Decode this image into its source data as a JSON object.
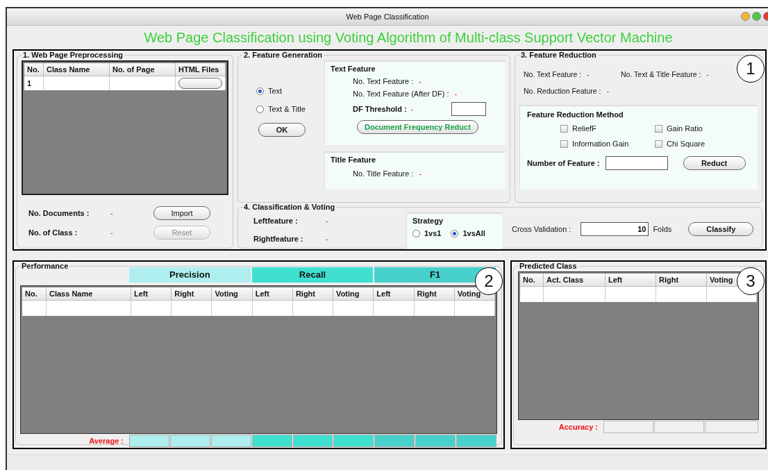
{
  "window": {
    "title": "Web Page Classification",
    "controls": [
      {
        "color": "#f2b630"
      },
      {
        "color": "#4cc94c"
      },
      {
        "color": "#e43b2f"
      }
    ]
  },
  "heading": "Web Page Classification using Voting Algorithm of Multi-class Support Vector Machine",
  "preprocessing": {
    "title": "1. Web Page Preprocessing",
    "columns": [
      "No.",
      "Class Name",
      "No. of Page",
      "HTML Files"
    ],
    "rows": [
      {
        "no": "1"
      }
    ],
    "stats": [
      {
        "label": "No. Documents :",
        "value": "-",
        "button": {
          "label": "Import",
          "disabled": false
        }
      },
      {
        "label": "No. of Class :",
        "value": "-",
        "button": {
          "label": "Reset",
          "disabled": true
        }
      }
    ]
  },
  "feature_generation": {
    "title": "2. Feature Generation",
    "options": [
      {
        "label": "Text",
        "selected": true
      },
      {
        "label": "Text & Title",
        "selected": false
      }
    ],
    "ok_button": "OK",
    "text_feature": {
      "title": "Text Feature",
      "stats": [
        {
          "label": "No. Text Feature :",
          "value": "-"
        },
        {
          "label": "No. Text Feature (After DF) :",
          "value": "-"
        }
      ],
      "threshold_label": "DF Threshold :",
      "threshold_value": "-",
      "button": "Document Frequency Reduct"
    },
    "title_feature": {
      "title": "Title Feature",
      "stats": [
        {
          "label": "No. Title Feature :",
          "value": "-"
        }
      ]
    }
  },
  "feature_reduction": {
    "title": "3. Feature Reduction",
    "stats": [
      {
        "label": "No. Text Feature :",
        "value": "-"
      },
      {
        "label": "No. Text & Title Feature :",
        "value": "-"
      },
      {
        "label": "No. Reduction Feature :",
        "value": "-"
      }
    ],
    "method": {
      "title": "Feature Reduction Method",
      "options": [
        {
          "label": "ReliefF",
          "checked": false
        },
        {
          "label": "Gain Ratio",
          "checked": false
        },
        {
          "label": "Information Gain",
          "checked": false
        },
        {
          "label": "Chi Square",
          "checked": false
        }
      ],
      "number_label": "Number of Feature :",
      "button": "Reduct"
    }
  },
  "classification": {
    "title": "4. Classification & Voting",
    "stats": [
      {
        "label": "Leftfeature :",
        "value": "-"
      },
      {
        "label": "Rightfeature :",
        "value": "-"
      }
    ],
    "strategy": {
      "title": "Strategy",
      "options": [
        {
          "label": "1vs1",
          "selected": false
        },
        {
          "label": "1vsAll",
          "selected": true
        }
      ]
    },
    "cross_validation_label": "Cross Validation :",
    "folds_value": "10",
    "folds_unit": "Folds",
    "button": "Classify"
  },
  "performance": {
    "title": "Performance",
    "groups": [
      {
        "label": "Precision",
        "color": "#afeeee"
      },
      {
        "label": "Recall",
        "color": "#40e0d0"
      },
      {
        "label": "F1",
        "color": "#48d1cc"
      }
    ],
    "columns": [
      "No.",
      "Class Name",
      "Left",
      "Right",
      "Voting",
      "Left",
      "Right",
      "Voting",
      "Left",
      "Right",
      "Voting"
    ],
    "average_label": "Average :"
  },
  "predicted": {
    "title": "Predicted Class",
    "columns": [
      "No.",
      "Act. Class",
      "Left",
      "Right",
      "Voting"
    ],
    "accuracy_label": "Accuracy :"
  },
  "callouts": [
    "1",
    "2",
    "3"
  ]
}
